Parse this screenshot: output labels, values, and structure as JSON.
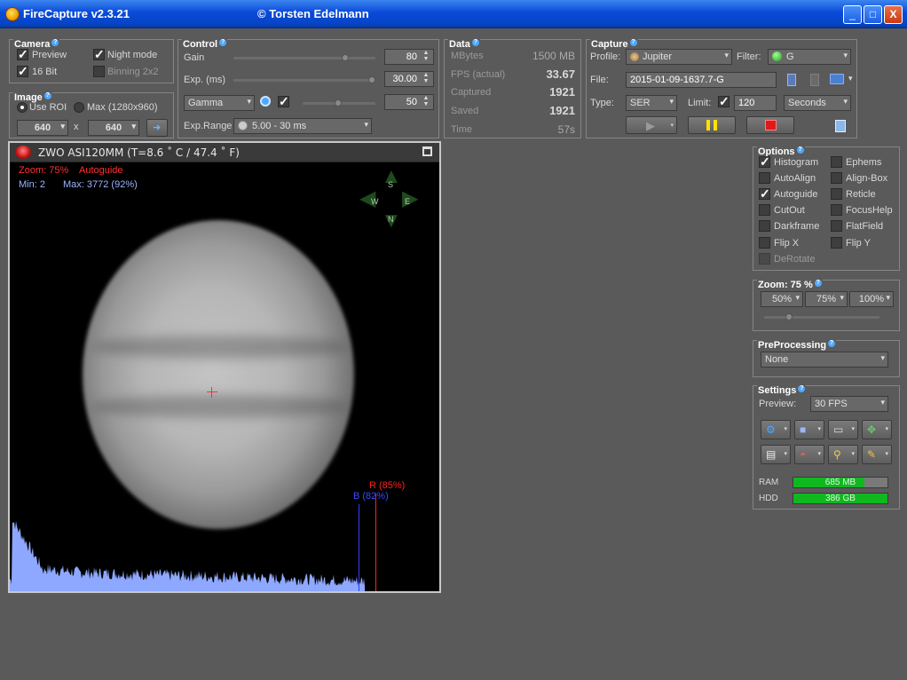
{
  "window": {
    "title": "FireCapture v2.3.21",
    "author": "© Torsten Edelmann",
    "minimize": "_",
    "maximize": "□",
    "close": "X"
  },
  "camera": {
    "title": "Camera",
    "preview": "Preview",
    "night_mode": "Night mode",
    "bit16": "16 Bit",
    "binning": "Binning 2x2"
  },
  "image": {
    "title": "Image",
    "use_roi": "Use ROI",
    "max": "Max (1280x960)",
    "width": "640",
    "height": "640",
    "times": "x"
  },
  "control": {
    "title": "Control",
    "gain_label": "Gain",
    "gain_value": "80",
    "exp_label": "Exp. (ms)",
    "exp_value": "30.00",
    "gamma_select": "Gamma",
    "gamma_value": "50",
    "exp_range_label": "Exp.Range",
    "exp_range_value": "5.00 - 30 ms"
  },
  "data": {
    "title": "Data",
    "mbytes_label": "MBytes",
    "mbytes_value": "1500 MB",
    "fps_label": "FPS (actual)",
    "fps_value": "33.67",
    "captured_label": "Captured",
    "captured_value": "1921",
    "saved_label": "Saved",
    "saved_value": "1921",
    "time_label": "Time",
    "time_value": "57s"
  },
  "capture": {
    "title": "Capture",
    "profile_label": "Profile:",
    "profile_value": "Jupiter",
    "filter_label": "Filter:",
    "filter_value": "G",
    "file_label": "File:",
    "file_value": "2015-01-09-1637.7-G",
    "type_label": "Type:",
    "type_value": "SER",
    "limit_label": "Limit:",
    "limit_value": "120",
    "limit_unit": "Seconds"
  },
  "preview": {
    "camera_title": "ZWO ASI120MM  (T=8.6 ˚ C / 47.4 ˚ F)",
    "zoom": "Zoom: 75%",
    "autoguide": "Autoguide",
    "min": "Min: 2",
    "max": "Max: 3772 (92%)",
    "r_marker": "R (85%)",
    "b_marker": "B (82%)",
    "nav_n": "N",
    "nav_s": "S",
    "nav_e": "E",
    "nav_w": "W"
  },
  "options": {
    "title": "Options",
    "histogram": "Histogram",
    "ephems": "Ephems",
    "autoalign": "AutoAlign",
    "alignbox": "Align-Box",
    "autoguide": "Autoguide",
    "reticle": "Reticle",
    "cutout": "CutOut",
    "focushelp": "FocusHelp",
    "darkframe": "Darkframe",
    "flatfield": "FlatField",
    "flipx": "Flip X",
    "flipy": "Flip Y",
    "derotate": "DeRotate"
  },
  "zoom": {
    "title": "Zoom: 75 %",
    "z50": "50%",
    "z75": "75%",
    "z100": "100%",
    "level": 0.2
  },
  "preprocessing": {
    "title": "PreProcessing",
    "value": "None"
  },
  "settings": {
    "title": "Settings",
    "preview_label": "Preview:",
    "preview_value": "30 FPS",
    "ram_label": "RAM",
    "ram_value": "685 MB",
    "ram_fill": 0.75,
    "hdd_label": "HDD",
    "hdd_value": "386 GB",
    "hdd_fill": 1.0
  },
  "colors": {
    "histogram": "#8ea8ff",
    "red_marker": "#ff2020",
    "blue_marker": "#3040ff",
    "meter_green": "#10b820"
  }
}
